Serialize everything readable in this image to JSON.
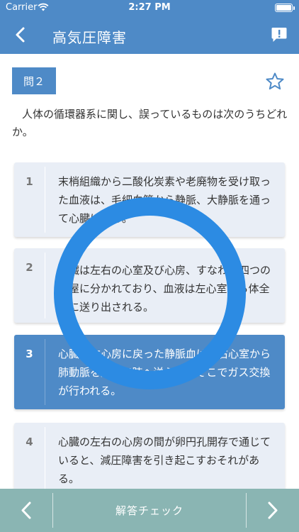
{
  "status_bar": {
    "carrier": "Carrier",
    "time": "2:27 PM"
  },
  "nav": {
    "title": "高気圧障害"
  },
  "question": {
    "label": "問２",
    "text": "人体の循環器系に関し、誤っているものは次のうちどれか。"
  },
  "choices": [
    {
      "number": "1",
      "text": "末梢組織から二酸化炭素や老廃物を受け取った血液は、毛細血管から静脈、大静脈を通って心臓に戻る。"
    },
    {
      "number": "2",
      "text": "心臓は左右の心室及び心房、すなわち四つの部屋に分かれており、血液は左心室から体全体に送り出される。"
    },
    {
      "number": "3",
      "text": "心臓の右心房に戻った静脈血は、右心室から肺動脈を通って肺へ送られ、そこでガス交換が行われる。"
    },
    {
      "number": "4",
      "text": "心臓の左右の心房の間が卵円孔開存で通じていると、減圧障害を引き起こすおそれがある。"
    }
  ],
  "selected_choice": "3",
  "bottom_bar": {
    "check_label": "解答チェック"
  },
  "colors": {
    "accent": "#4e8ac7",
    "ring": "#2c8be3",
    "bottom_bar": "#8ab5b3",
    "choice_bg": "#e9eef6"
  },
  "icons": {
    "back": "chevron-left-icon",
    "report": "report-bubble-icon",
    "favorite": "star-outline-icon",
    "prev": "chevron-left-icon",
    "next": "chevron-right-icon"
  }
}
